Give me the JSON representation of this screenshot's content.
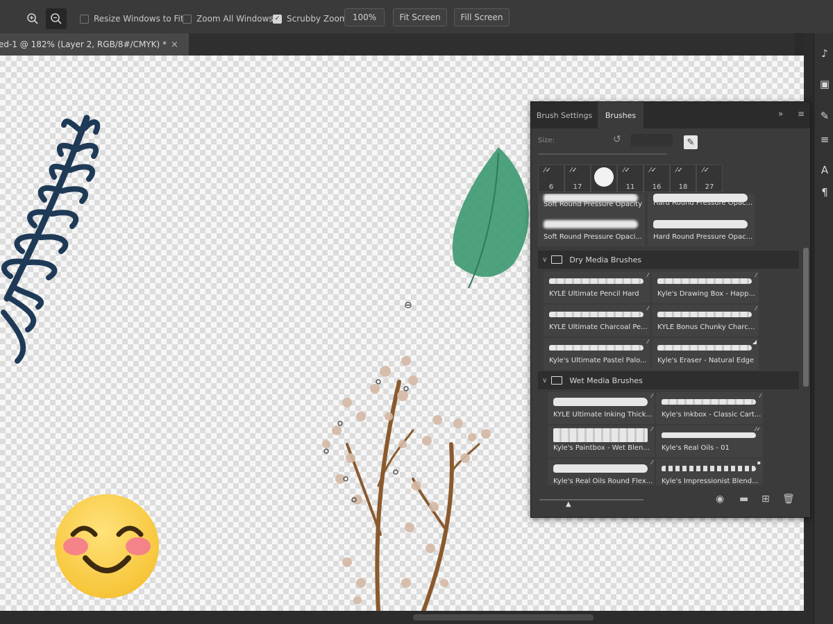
{
  "toolbar": {
    "resize_windows": "Resize Windows to Fit",
    "zoom_all": "Zoom All Windows",
    "scrubby_zoom": "Scrubby Zoom",
    "zoom_value": "100%",
    "fit_screen": "Fit Screen",
    "fill_screen": "Fill Screen",
    "scrubby_checked": true
  },
  "document": {
    "tab_title": "ed-1 @ 182% (Layer 2, RGB/8#/CMYK) *",
    "close": "×"
  },
  "panel": {
    "tabs": [
      "Brush Settings",
      "Brushes"
    ],
    "active_tab": "Brushes",
    "size_label": "Size:",
    "recent_sizes": [
      "6",
      "17",
      "",
      "11",
      "16",
      "18",
      "27"
    ],
    "rows": [
      {
        "left": "Soft Round Pressure Opacity",
        "right": "Hard Round Pressure Opac..."
      },
      {
        "left": "Soft Round Pressure Opaci...",
        "right": "Hard Round Pressure Opac..."
      }
    ],
    "groups": [
      {
        "name": "Dry Media Brushes",
        "brushes": [
          {
            "left": "KYLE Ultimate Pencil Hard",
            "right": "Kyle's Drawing Box - Happ..."
          },
          {
            "left": "KYLE Ultimate Charcoal Pe...",
            "right": "KYLE Bonus Chunky Charc..."
          },
          {
            "left": "Kyle's Ultimate Pastel Palo...",
            "right": "Kyle's Eraser - Natural Edge"
          }
        ]
      },
      {
        "name": "Wet Media Brushes",
        "brushes": [
          {
            "left": "KYLE Ultimate Inking Thick...",
            "right": "Kyle's Inkbox - Classic Cart..."
          },
          {
            "left": "Kyle's Paintbox - Wet Blen...",
            "right": "Kyle's Real Oils - 01"
          },
          {
            "left": "Kyle's Real Oils Round Flex...",
            "right": "Kyle's Impressionist Blend..."
          }
        ]
      }
    ]
  },
  "colors": {
    "fern": "#1f3a57",
    "leaf": "#3f9a72",
    "stem": "#8a5a2e",
    "dots": "#d5b9a5"
  }
}
